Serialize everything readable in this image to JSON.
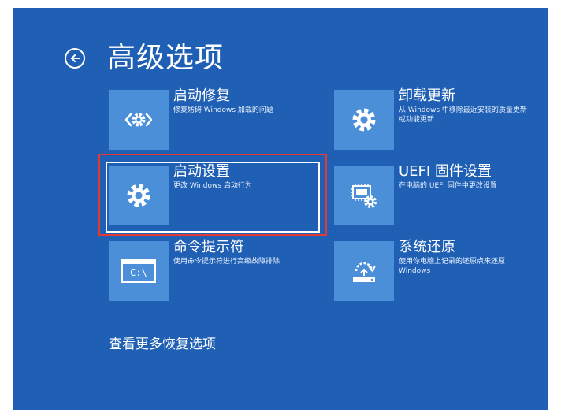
{
  "header": {
    "title": "高级选项",
    "back_icon": "back-arrow-icon"
  },
  "tiles": [
    {
      "id": "startup-repair",
      "title": "启动修复",
      "desc": "修复妨碍 Windows 加载的问题",
      "icon": "startup-repair-icon"
    },
    {
      "id": "uninstall-updates",
      "title": "卸载更新",
      "desc": "从 Windows 中移除最近安装的质量更新或功能更新",
      "icon": "gear-icon"
    },
    {
      "id": "startup-settings",
      "title": "启动设置",
      "desc": "更改 Windows 启动行为",
      "icon": "gear-icon"
    },
    {
      "id": "uefi-firmware",
      "title": "UEFI 固件设置",
      "desc": "在电脑的 UEFI 固件中更改设置",
      "icon": "uefi-chip-icon"
    },
    {
      "id": "command-prompt",
      "title": "命令提示符",
      "desc": "使用命令提示符进行高级故障排除",
      "icon": "command-prompt-icon",
      "icon_text": "C:\\"
    },
    {
      "id": "system-restore",
      "title": "系统还原",
      "desc": "使用你电脑上记录的还原点来还原 Windows",
      "icon": "system-restore-icon"
    }
  ],
  "more_options": {
    "label": "查看更多恢复选项"
  },
  "colors": {
    "background": "#1f5fb4",
    "tile": "#4a8fd8",
    "highlight": "#e53935",
    "text": "#ffffff"
  }
}
